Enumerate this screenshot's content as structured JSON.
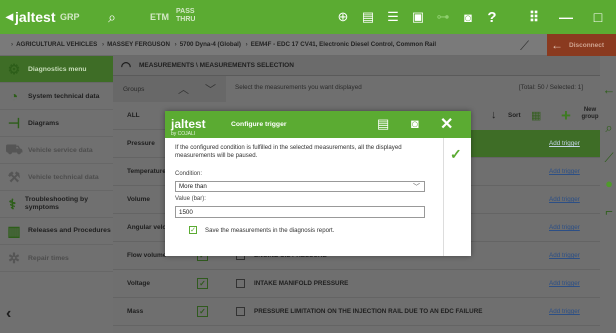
{
  "topbar": {
    "logo_text": "jaltest",
    "logo_sub": "by COJALI",
    "grp_label": "GRP",
    "etm_label": "ETM",
    "pass_thru_label": "PASS THRU",
    "icons": [
      "search-icon",
      "globe-icon",
      "report-icon",
      "list-icon",
      "inbox-icon",
      "link-icon",
      "camera-icon",
      "help-icon",
      "grid-icon",
      "minimize-icon",
      "maximize-icon"
    ]
  },
  "breadcrumb": [
    "AGRICULTURAL VEHICLES",
    "MASSEY FERGUSON",
    "5700 Dyna-4 (Global)",
    "EEM4F - EDC 17 CV41, Electronic Diesel Control, Common Rail"
  ],
  "disconnect_label": "Disconnect",
  "nav": [
    {
      "label": "Diagnostics menu",
      "icon": "diagnostics-icon",
      "state": "active"
    },
    {
      "label": "System technical data",
      "icon": "gauge-icon",
      "state": "normal"
    },
    {
      "label": "Diagrams",
      "icon": "diagram-icon",
      "state": "normal"
    },
    {
      "label": "Vehicle service data",
      "icon": "car-icon",
      "state": "dim"
    },
    {
      "label": "Vehicle technical data",
      "icon": "wrench-icon",
      "state": "dim"
    },
    {
      "label": "Troubleshooting by symptoms",
      "icon": "troubleshoot-icon",
      "state": "normal"
    },
    {
      "label": "Releases and Procedures",
      "icon": "procedures-icon",
      "state": "normal"
    },
    {
      "label": "Repair times",
      "icon": "gear-icon",
      "state": "dim"
    }
  ],
  "measurements": {
    "title": "MEASUREMENTS \\ MEASUREMENTS SELECTION",
    "groups_label": "Groups",
    "select_text": "Select the measurements you want displayed",
    "total_text": "[Total: 50 / Selected: 1]",
    "sort_label": "Sort",
    "new_group_label": "New group",
    "groups": [
      "ALL",
      "Pressure",
      "Temperature",
      "Volume",
      "Angular velo",
      "Flow volume",
      "Voltage",
      "Mass"
    ],
    "rows": [
      {
        "name": "",
        "link": "Add trigger",
        "highlight": true
      },
      {
        "name": "",
        "link": "Add trigger",
        "highlight": false
      },
      {
        "name": "",
        "link": "Add trigger",
        "highlight": false
      },
      {
        "name": "",
        "link": "Add trigger",
        "highlight": false
      },
      {
        "name": "ENGINE OIL PRESSURE",
        "link": "Add trigger",
        "highlight": false
      },
      {
        "name": "INTAKE MANIFOLD PRESSURE",
        "link": "Add trigger",
        "highlight": false
      },
      {
        "name": "PRESSURE LIMITATION  ON THE INJECTION RAIL DUE TO AN EDC FAILURE",
        "link": "Add trigger",
        "highlight": false
      }
    ]
  },
  "modal": {
    "logo_text": "jaltest",
    "logo_sub": "by COJALI",
    "title": "Configure trigger",
    "description": "If the configured condition is fulfilled in the selected measurements, all the displayed measurements will be paused.",
    "condition_label": "Condition:",
    "condition_value": "More than",
    "value_label": "Value (bar):",
    "value_value": "1500",
    "save_label": "Save the measurements in the diagnosis report.",
    "save_checked": true
  },
  "colors": {
    "brand_green": "#5bab32",
    "dark_green": "#3e6d26",
    "disconnect": "#8a3a1f"
  }
}
